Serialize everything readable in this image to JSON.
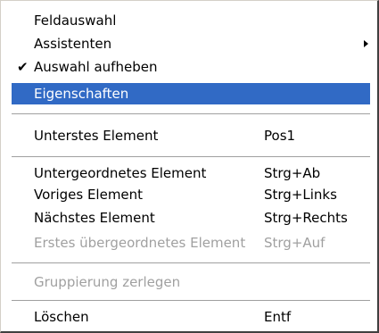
{
  "menu": {
    "items": [
      {
        "label": "Feldauswahl",
        "shortcut": "",
        "state": "normal"
      },
      {
        "label": "Assistenten",
        "shortcut": "",
        "state": "normal",
        "submenu": true
      },
      {
        "label": "Auswahl aufheben",
        "shortcut": "",
        "state": "checked",
        "check_glyph": "✔"
      },
      {
        "label": "Eigenschaften",
        "shortcut": "",
        "state": "highlighted"
      },
      {
        "label": "Unterstes Element",
        "shortcut": "Pos1",
        "state": "normal"
      },
      {
        "label": "Untergeordnetes Element",
        "shortcut": "Strg+Ab",
        "state": "normal"
      },
      {
        "label": "Voriges Element",
        "shortcut": "Strg+Links",
        "state": "normal"
      },
      {
        "label": "Nächstes Element",
        "shortcut": "Strg+Rechts",
        "state": "normal"
      },
      {
        "label": "Erstes übergeordnetes Element",
        "shortcut": "Strg+Auf",
        "state": "disabled"
      },
      {
        "label": "Gruppierung zerlegen",
        "shortcut": "",
        "state": "disabled"
      },
      {
        "label": "Löschen",
        "shortcut": "Entf",
        "state": "normal"
      }
    ]
  },
  "colors": {
    "highlight": "#316ac5",
    "disabled_text": "#a0a0a0",
    "separator": "#a0a0a0"
  },
  "icons": {
    "check": "checkmark-icon",
    "submenu": "submenu-arrow-icon"
  }
}
